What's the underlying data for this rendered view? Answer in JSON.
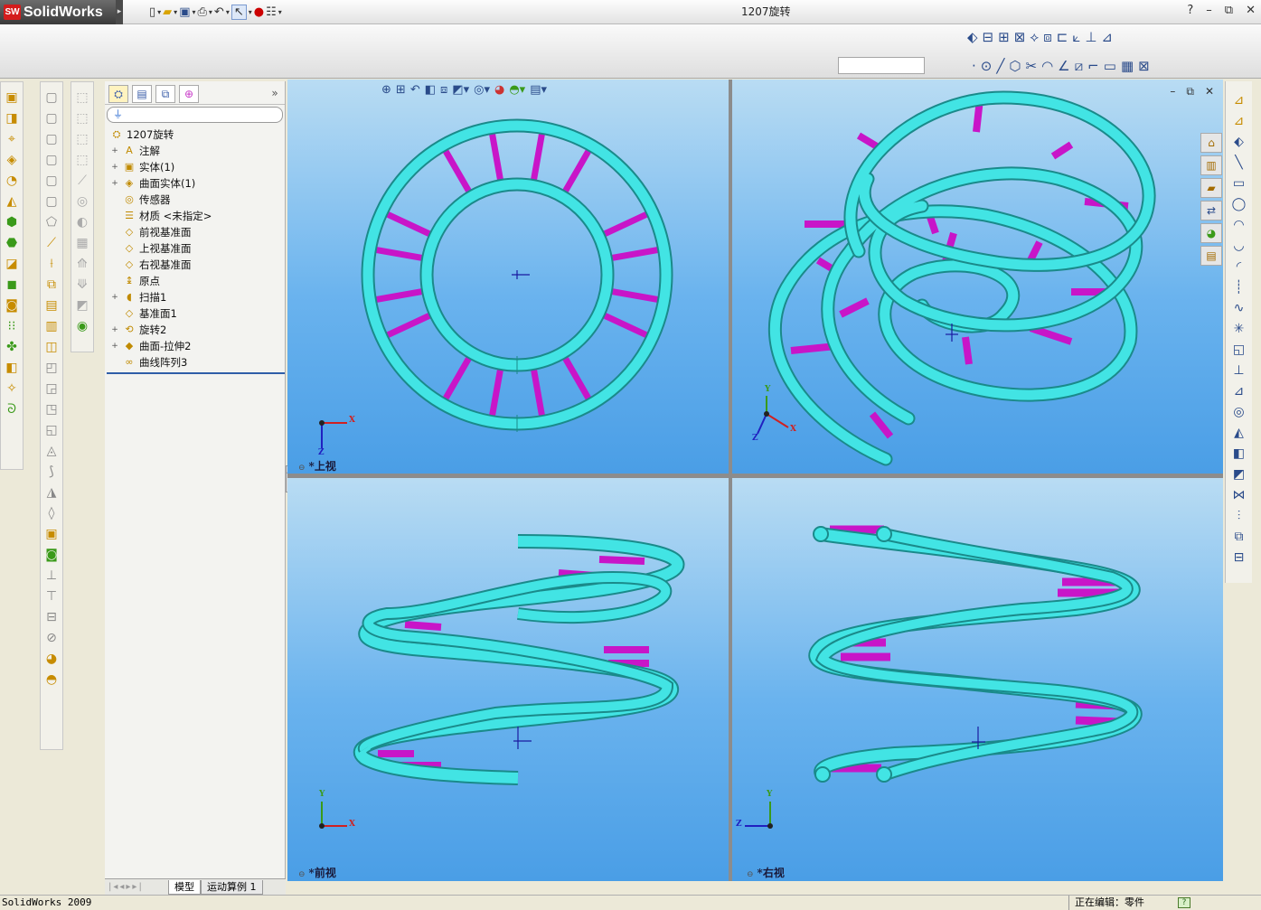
{
  "app": {
    "logo_badge": "SW",
    "logo_text": "SolidWorks",
    "window_title": "1207旋转",
    "help": "?",
    "status_left": "SolidWorks 2009",
    "status_right": "正在编辑：零件",
    "status_help": "?"
  },
  "feature_tree": {
    "root": "1207旋转",
    "items": [
      {
        "label": "注解",
        "icon": "A",
        "expand": "+"
      },
      {
        "label": "实体(1)",
        "icon": "▣",
        "expand": "+"
      },
      {
        "label": "曲面实体(1)",
        "icon": "◈",
        "expand": "+"
      },
      {
        "label": "传感器",
        "icon": "◎",
        "expand": ""
      },
      {
        "label": "材质 <未指定>",
        "icon": "☰",
        "expand": ""
      },
      {
        "label": "前视基准面",
        "icon": "◇",
        "expand": ""
      },
      {
        "label": "上视基准面",
        "icon": "◇",
        "expand": ""
      },
      {
        "label": "右视基准面",
        "icon": "◇",
        "expand": ""
      },
      {
        "label": "原点",
        "icon": "↨",
        "expand": ""
      },
      {
        "label": "扫描1",
        "icon": "◖",
        "expand": "+"
      },
      {
        "label": "基准面1",
        "icon": "◇",
        "expand": ""
      },
      {
        "label": "旋转2",
        "icon": "⟲",
        "expand": "+"
      },
      {
        "label": "曲面-拉伸2",
        "icon": "◆",
        "expand": "+"
      },
      {
        "label": "曲线阵列3",
        "icon": "∞",
        "expand": ""
      }
    ]
  },
  "bottom_tabs": {
    "model": "模型",
    "motion": "运动算例 1"
  },
  "viewports": {
    "top_label": "*上视",
    "iso_label": "",
    "front_label": "*前视",
    "right_label": "*右视"
  },
  "axes": {
    "x": "X",
    "y": "Y",
    "z": "Z"
  },
  "colors": {
    "tube": "#3de6e6",
    "strut": "#c815c8",
    "viewport_top": "#b9dcf3",
    "viewport_bottom": "#4a9ee6"
  }
}
